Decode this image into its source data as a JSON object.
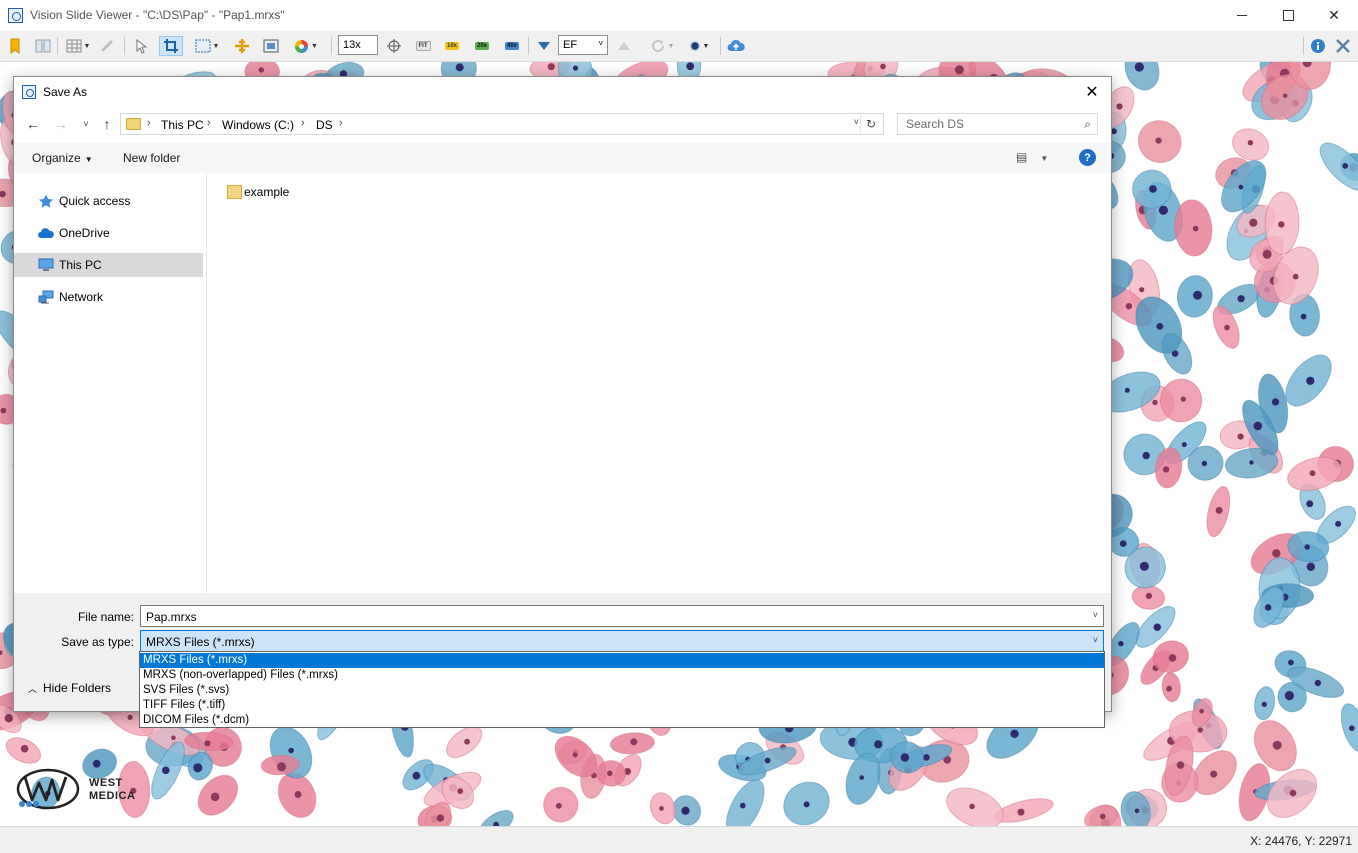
{
  "app": {
    "title": "Vision Slide Viewer - \"C:\\DS\\Pap\" - \"Pap1.mrxs\"",
    "window_controls": {
      "minimize": "minimize-icon",
      "maximize": "maximize-icon",
      "close": "✕"
    }
  },
  "toolbar": {
    "zoom_value": "13x",
    "zoom_presets": [
      "FIT",
      "10x",
      "20x",
      "40x"
    ],
    "focus_mode": "EF",
    "icons": [
      "bookmark-icon",
      "split-view-icon",
      "grid-icon",
      "link-icon",
      "pointer-icon",
      "crop-icon",
      "rect-select-icon",
      "measure-icon",
      "screenshot-icon",
      "color-wheel-icon",
      "crosshair-icon",
      "triangle-down-icon",
      "triangle-up-icon",
      "rotate-icon",
      "dot-icon",
      "cloud-upload-icon",
      "info-icon",
      "tools-icon"
    ]
  },
  "dialog": {
    "title": "Save As",
    "breadcrumb": [
      "This PC",
      "Windows (C:)",
      "DS"
    ],
    "search_placeholder": "Search DS",
    "commands": {
      "organize": "Organize",
      "new_folder": "New folder",
      "help": "?"
    },
    "nav_items": [
      {
        "label": "Quick access",
        "icon": "star-icon",
        "selected": false
      },
      {
        "label": "OneDrive",
        "icon": "cloud-icon",
        "selected": false
      },
      {
        "label": "This PC",
        "icon": "computer-icon",
        "selected": true
      },
      {
        "label": "Network",
        "icon": "network-icon",
        "selected": false
      }
    ],
    "files": [
      {
        "name": "example",
        "type": "folder"
      }
    ],
    "file_name_label": "File name:",
    "file_name_value": "Pap.mrxs",
    "save_type_label": "Save as type:",
    "save_type_value": "MRXS Files (*.mrxs)",
    "hide_folders": "Hide Folders",
    "type_options": [
      "MRXS Files (*.mrxs)",
      "MRXS (non-overlapped) Files (*.mrxs)",
      "SVS Files (*.svs)",
      "TIFF Files (*.tiff)",
      "DICOM Files (*.dcm)"
    ],
    "type_selected_index": 0
  },
  "statusbar": {
    "coords": "X: 24476, Y: 22971"
  },
  "logo": {
    "line1": "WEST",
    "line2": "MEDICA"
  },
  "colors": {
    "accent": "#0078d7",
    "cell_pink": "#e8899e",
    "cell_blue": "#5aa3c8",
    "nucleus": "#3a2c6e"
  }
}
